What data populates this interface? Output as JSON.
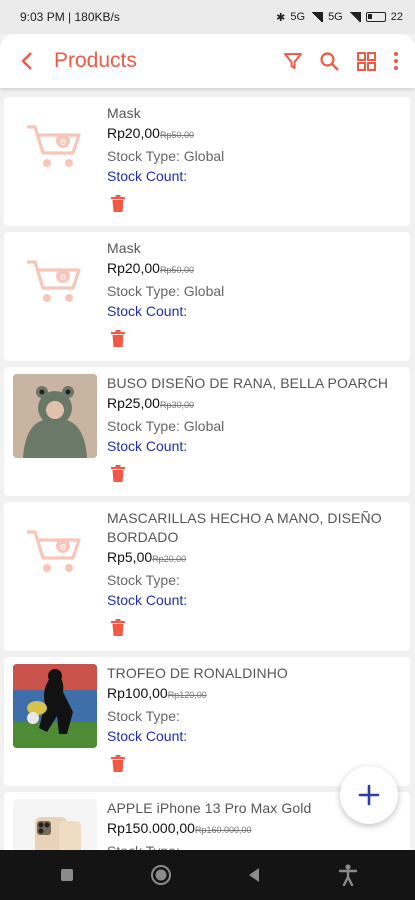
{
  "status_bar": {
    "time_speed": "9:03 PM | 180KB/s",
    "network_1": "5G",
    "network_2": "5G",
    "battery": "22"
  },
  "app_bar": {
    "title": "Products",
    "icons": [
      "back-arrow-icon",
      "filter-icon",
      "search-icon",
      "grid-view-icon",
      "more-vert-icon"
    ],
    "accent_color": "#ee5a45"
  },
  "products": [
    {
      "name": "Mask",
      "price": "Rp20,00",
      "old_price": "Rp50,00",
      "stock_type": "Stock Type: Global",
      "stock_count": "Stock Count:",
      "image": "cart-placeholder-icon"
    },
    {
      "name": "Mask",
      "price": "Rp20,00",
      "old_price": "Rp50,00",
      "stock_type": "Stock Type: Global",
      "stock_count": "Stock Count:",
      "image": "cart-placeholder-icon"
    },
    {
      "name": "BUSO DISEÑO DE RANA, BELLA POARCH",
      "price": "Rp25,00",
      "old_price": "Rp30,00",
      "stock_type": "Stock Type: Global",
      "stock_count": "Stock Count:",
      "image": "hoodie-photo"
    },
    {
      "name": "MASCARILLAS HECHO A MANO, DISEÑO BORDADO",
      "price": "Rp5,00",
      "old_price": "Rp20,00",
      "stock_type": "Stock Type:",
      "stock_count": "Stock Count:",
      "image": "cart-placeholder-icon"
    },
    {
      "name": "TROFEO DE RONALDINHO",
      "price": "Rp100,00",
      "old_price": "Rp120,00",
      "stock_type": "Stock Type:",
      "stock_count": "Stock Count:",
      "image": "soccer-photo"
    },
    {
      "name": "APPLE iPhone 13 Pro Max Gold",
      "price": "Rp150.000,00",
      "old_price": "Rp160.000,00",
      "stock_type": "Stock Type:",
      "stock_count": "",
      "image": "iphone-photo"
    }
  ],
  "colors": {
    "price_strike": "#777777",
    "stock_count": "#1e2fa8",
    "delete": "#ee5a45"
  },
  "fab": {
    "icon": "plus-icon"
  },
  "nav_bar": {
    "icons": [
      "recents-square-icon",
      "home-circle-icon",
      "back-triangle-icon",
      "accessibility-icon"
    ]
  }
}
